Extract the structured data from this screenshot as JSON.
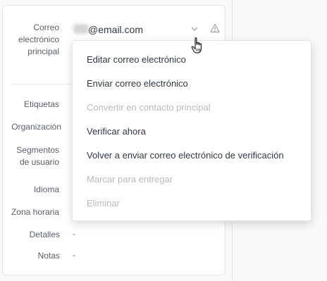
{
  "fields": {
    "primary_email_label": [
      "Correo",
      "electrónico",
      "principal"
    ],
    "primary_email_value": "@email.com",
    "tags_label": "Etiquetas",
    "organization_label": "Organización",
    "user_segments_label": [
      "Segmentos",
      "de usuario"
    ],
    "language_label": "Idioma",
    "timezone_label": "Zona horaria",
    "details_label": "Detalles",
    "details_value": "-",
    "notes_label": "Notas",
    "notes_value": "-"
  },
  "menu": {
    "items": [
      {
        "label": "Editar correo electrónico",
        "enabled": true
      },
      {
        "label": "Enviar correo electrónico",
        "enabled": true
      },
      {
        "label": "Convertir en contacto principal",
        "enabled": false
      },
      {
        "label": "Verificar ahora",
        "enabled": true
      },
      {
        "label": "Volver a enviar correo electrónico de verificación",
        "enabled": true
      },
      {
        "label": "Marcar para entregar",
        "enabled": false
      },
      {
        "label": "Eliminar",
        "enabled": false
      }
    ]
  },
  "icons": {
    "dropdown": "chevron-down-icon",
    "warning": "warning-triangle-icon",
    "cursor": "hand-pointer-icon"
  },
  "colors": {
    "text": "#2f3941",
    "label": "#5a6169",
    "disabled": "#b6bcc2",
    "border": "#e3e5e7"
  }
}
